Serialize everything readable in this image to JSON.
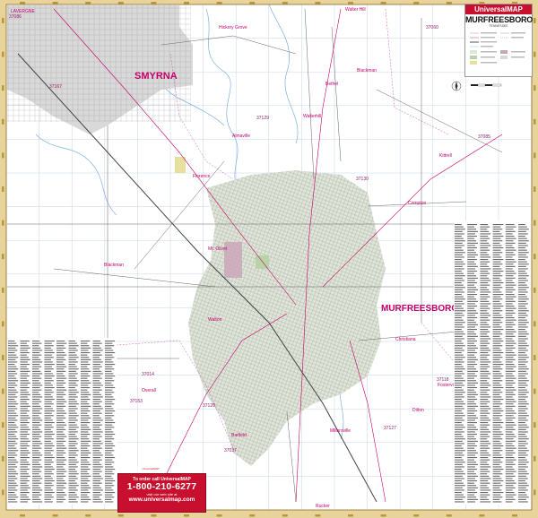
{
  "brand": {
    "logo": "UniversalMAP",
    "title": "MURFREESBORO",
    "subtitle": "TENNESSEE"
  },
  "promo": {
    "line1": "To order call UniversalMAP",
    "phone": "1-800-210-6277",
    "line3": "visit our web site at",
    "url": "www.universalmap.com"
  },
  "small_logo": "UniversalMAP",
  "places": [
    {
      "name": "LAVERGNE",
      "cls": "place"
    },
    {
      "name": "SMYRNA",
      "cls": "city-big"
    },
    {
      "name": "MURFREESBORO",
      "cls": "city-big"
    },
    {
      "name": "Hickory Grove",
      "cls": "place"
    },
    {
      "name": "Walter Hill",
      "cls": "place"
    },
    {
      "name": "Bethel",
      "cls": "place"
    },
    {
      "name": "Walterhill",
      "cls": "place"
    },
    {
      "name": "Kittrell",
      "cls": "place"
    },
    {
      "name": "Compton",
      "cls": "place"
    },
    {
      "name": "Blackman",
      "cls": "place"
    },
    {
      "name": "Florence",
      "cls": "place"
    },
    {
      "name": "Mt. Olivet",
      "cls": "place"
    },
    {
      "name": "Walton",
      "cls": "place"
    },
    {
      "name": "Overall",
      "cls": "place"
    },
    {
      "name": "Barfield",
      "cls": "place"
    },
    {
      "name": "Millersville",
      "cls": "place"
    },
    {
      "name": "Christiana",
      "cls": "place"
    },
    {
      "name": "Rucker",
      "cls": "place"
    },
    {
      "name": "Blackman",
      "cls": "place"
    },
    {
      "name": "Dilton",
      "cls": "place"
    },
    {
      "name": "Almaville",
      "cls": "place"
    },
    {
      "name": "Fosterville",
      "cls": "place"
    }
  ],
  "zips": [
    "37086",
    "37060",
    "37167",
    "37129",
    "37085",
    "37130",
    "37153",
    "37127",
    "37037",
    "37128",
    "37014",
    "37118"
  ],
  "colors": {
    "frame": "#f3e9c9",
    "map_bg": "#ffffff",
    "urban": "#dfe6d8",
    "smyrna": "#d9d9d9",
    "roads": "#555555",
    "highway": "#c4006a",
    "water": "#7fb0e0",
    "promo": "#c8102e"
  },
  "icons": [
    "compass-icon",
    "scale-bar"
  ]
}
